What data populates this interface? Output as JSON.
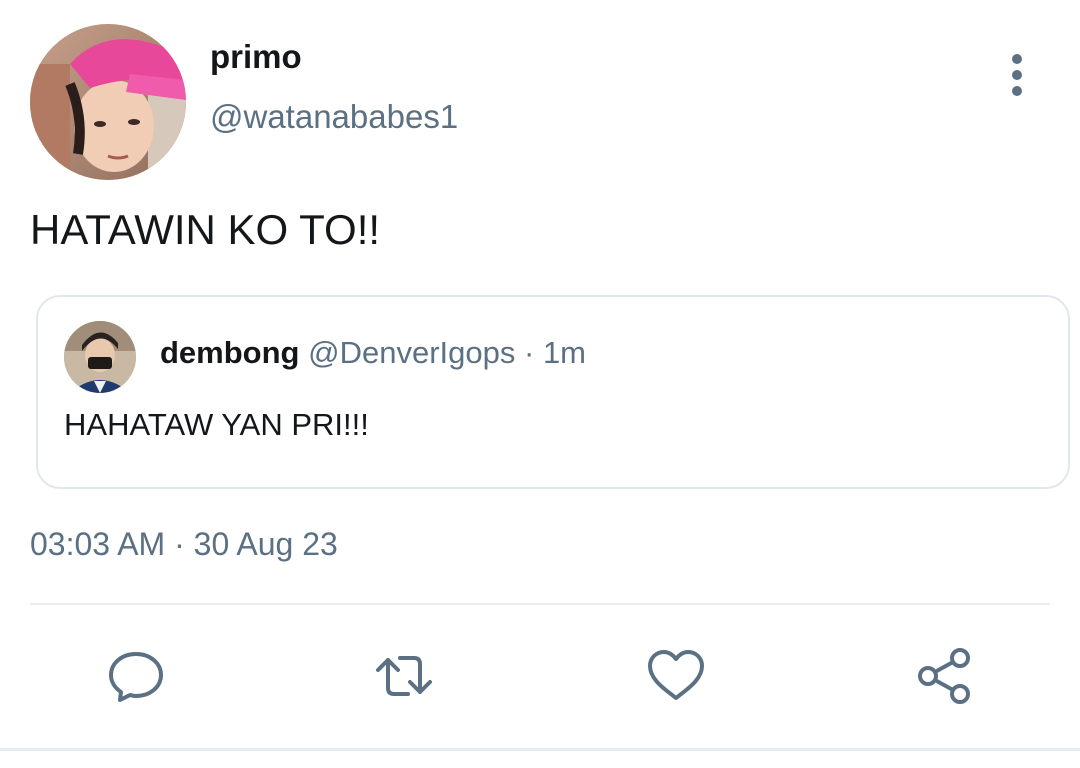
{
  "tweet": {
    "author": {
      "display_name": "primo",
      "handle": "@watanababes1",
      "avatar_icon": "profile-photo-pink-cap"
    },
    "text": "HATAWIN KO TO!!",
    "more_icon": "vertical-dots-icon",
    "quoted": {
      "display_name": "dembong",
      "handle": "@DenverIgops",
      "separator": " · ",
      "time": "1m",
      "text": "HAHATAW YAN PRI!!!",
      "avatar_icon": "profile-photo"
    },
    "timestamp": {
      "time": "03:03 AM",
      "separator": " · ",
      "date": "30 Aug 23"
    }
  },
  "actions": {
    "reply_icon": "speech-bubble-icon",
    "retweet_icon": "retweet-icon",
    "like_icon": "heart-icon",
    "share_icon": "share-icon"
  },
  "colors": {
    "primary_text": "#14171a",
    "secondary_text": "#5b7083",
    "border": "#e1e8ed",
    "icon": "#5b7083"
  }
}
